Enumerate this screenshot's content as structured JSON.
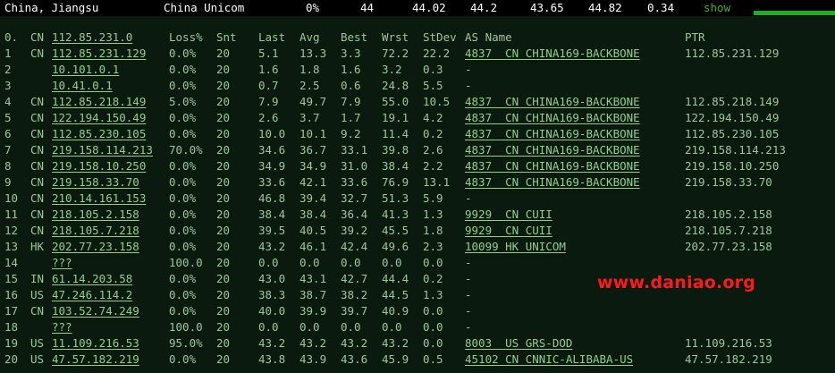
{
  "summary": {
    "location": "China, Jiangsu",
    "isp": "China Unicom",
    "loss": "0%",
    "snt": "44",
    "last": "44.02",
    "avg": "44.2",
    "best": "43.65",
    "wrst": "44.82",
    "stdev": "0.34",
    "show": "show"
  },
  "headers": {
    "index": "0.",
    "cc": "CN",
    "host": "112.85.231.0",
    "loss": "Loss%",
    "snt": "Snt",
    "last": "Last",
    "avg": "Avg",
    "best": "Best",
    "wrst": "Wrst",
    "stdev": "StDev",
    "as": "AS Name",
    "ptr": "PTR"
  },
  "hops": [
    {
      "n": "1",
      "cc": "CN",
      "host": "112.85.231.129",
      "loss": "0.0%",
      "snt": "20",
      "last": "5.1",
      "avg": "13.3",
      "best": "3.3",
      "wrst": "72.2",
      "stdev": "22.2",
      "as": "4837  CN CHINA169-BACKBONE",
      "ptr": "112.85.231.129"
    },
    {
      "n": "2",
      "cc": "",
      "host": "10.101.0.1",
      "loss": "0.0%",
      "snt": "20",
      "last": "1.6",
      "avg": "1.8",
      "best": "1.6",
      "wrst": "3.2",
      "stdev": "0.3",
      "as": "-",
      "ptr": ""
    },
    {
      "n": "3",
      "cc": "",
      "host": "10.41.0.1",
      "loss": "0.0%",
      "snt": "20",
      "last": "0.7",
      "avg": "2.5",
      "best": "0.6",
      "wrst": "24.8",
      "stdev": "5.5",
      "as": "-",
      "ptr": ""
    },
    {
      "n": "4",
      "cc": "CN",
      "host": "112.85.218.149",
      "loss": "5.0%",
      "snt": "20",
      "last": "7.9",
      "avg": "49.7",
      "best": "7.9",
      "wrst": "55.0",
      "stdev": "10.5",
      "as": "4837  CN CHINA169-BACKBONE",
      "ptr": "112.85.218.149"
    },
    {
      "n": "5",
      "cc": "CN",
      "host": "122.194.150.49",
      "loss": "0.0%",
      "snt": "20",
      "last": "2.6",
      "avg": "3.7",
      "best": "1.7",
      "wrst": "19.1",
      "stdev": "4.2",
      "as": "4837  CN CHINA169-BACKBONE",
      "ptr": "122.194.150.49"
    },
    {
      "n": "6",
      "cc": "CN",
      "host": "112.85.230.105",
      "loss": "0.0%",
      "snt": "20",
      "last": "10.0",
      "avg": "10.1",
      "best": "9.2",
      "wrst": "11.4",
      "stdev": "0.2",
      "as": "4837  CN CHINA169-BACKBONE",
      "ptr": "112.85.230.105"
    },
    {
      "n": "7",
      "cc": "CN",
      "host": "219.158.114.213",
      "loss": "70.0%",
      "snt": "20",
      "last": "34.6",
      "avg": "36.7",
      "best": "33.1",
      "wrst": "39.8",
      "stdev": "2.6",
      "as": "4837  CN CHINA169-BACKBONE",
      "ptr": "219.158.114.213"
    },
    {
      "n": "8",
      "cc": "CN",
      "host": "219.158.10.250",
      "loss": "0.0%",
      "snt": "20",
      "last": "34.9",
      "avg": "34.9",
      "best": "31.0",
      "wrst": "38.4",
      "stdev": "2.2",
      "as": "4837  CN CHINA169-BACKBONE",
      "ptr": "219.158.10.250"
    },
    {
      "n": "9",
      "cc": "CN",
      "host": "219.158.33.70",
      "loss": "0.0%",
      "snt": "20",
      "last": "33.6",
      "avg": "42.1",
      "best": "33.6",
      "wrst": "76.9",
      "stdev": "13.1",
      "as": "4837  CN CHINA169-BACKBONE",
      "ptr": "219.158.33.70"
    },
    {
      "n": "10",
      "cc": "CN",
      "host": "210.14.161.153",
      "loss": "0.0%",
      "snt": "20",
      "last": "46.8",
      "avg": "39.4",
      "best": "32.7",
      "wrst": "51.3",
      "stdev": "5.9",
      "as": "-",
      "ptr": ""
    },
    {
      "n": "11",
      "cc": "CN",
      "host": "218.105.2.158",
      "loss": "0.0%",
      "snt": "20",
      "last": "38.4",
      "avg": "38.4",
      "best": "36.4",
      "wrst": "41.3",
      "stdev": "1.3",
      "as": "9929  CN CUII",
      "ptr": "218.105.2.158"
    },
    {
      "n": "12",
      "cc": "CN",
      "host": "218.105.7.218",
      "loss": "0.0%",
      "snt": "20",
      "last": "39.5",
      "avg": "40.5",
      "best": "39.2",
      "wrst": "45.5",
      "stdev": "1.8",
      "as": "9929  CN CUII",
      "ptr": "218.105.7.218"
    },
    {
      "n": "13",
      "cc": "HK",
      "host": "202.77.23.158",
      "loss": "0.0%",
      "snt": "20",
      "last": "43.2",
      "avg": "46.1",
      "best": "42.4",
      "wrst": "49.6",
      "stdev": "2.3",
      "as": "10099 HK UNICOM",
      "ptr": "202.77.23.158"
    },
    {
      "n": "14",
      "cc": "",
      "host": "???",
      "loss": "100.0",
      "snt": "20",
      "last": "0.0",
      "avg": "0.0",
      "best": "0.0",
      "wrst": "0.0",
      "stdev": "0.0",
      "as": "-",
      "ptr": ""
    },
    {
      "n": "15",
      "cc": "IN",
      "host": "61.14.203.58",
      "loss": "0.0%",
      "snt": "20",
      "last": "43.0",
      "avg": "43.1",
      "best": "42.7",
      "wrst": "44.4",
      "stdev": "0.2",
      "as": "-",
      "ptr": ""
    },
    {
      "n": "16",
      "cc": "US",
      "host": "47.246.114.2",
      "loss": "0.0%",
      "snt": "20",
      "last": "38.3",
      "avg": "38.7",
      "best": "38.2",
      "wrst": "44.5",
      "stdev": "1.3",
      "as": "-",
      "ptr": ""
    },
    {
      "n": "17",
      "cc": "CN",
      "host": "103.52.74.249",
      "loss": "0.0%",
      "snt": "20",
      "last": "40.0",
      "avg": "39.9",
      "best": "39.7",
      "wrst": "40.9",
      "stdev": "0.0",
      "as": "-",
      "ptr": ""
    },
    {
      "n": "18",
      "cc": "",
      "host": "???",
      "loss": "100.0",
      "snt": "20",
      "last": "0.0",
      "avg": "0.0",
      "best": "0.0",
      "wrst": "0.0",
      "stdev": "0.0",
      "as": "-",
      "ptr": ""
    },
    {
      "n": "19",
      "cc": "US",
      "host": "11.109.216.53",
      "loss": "95.0%",
      "snt": "20",
      "last": "43.2",
      "avg": "43.2",
      "best": "43.2",
      "wrst": "43.2",
      "stdev": "0.0",
      "as": "8003  US GRS-DOD",
      "ptr": "11.109.216.53"
    },
    {
      "n": "20",
      "cc": "US",
      "host": "47.57.182.219",
      "loss": "0.0%",
      "snt": "20",
      "last": "43.8",
      "avg": "43.9",
      "best": "43.6",
      "wrst": "45.9",
      "stdev": "0.5",
      "as": "45102 CN CNNIC-ALIBABA-US",
      "ptr": "47.57.182.219"
    }
  ],
  "watermark": "www.daniao.org",
  "colors": {
    "background": "#0b1a0e",
    "text": "#9cc79c",
    "accent": "#1fae1f",
    "watermark": "#ff1a1a"
  }
}
